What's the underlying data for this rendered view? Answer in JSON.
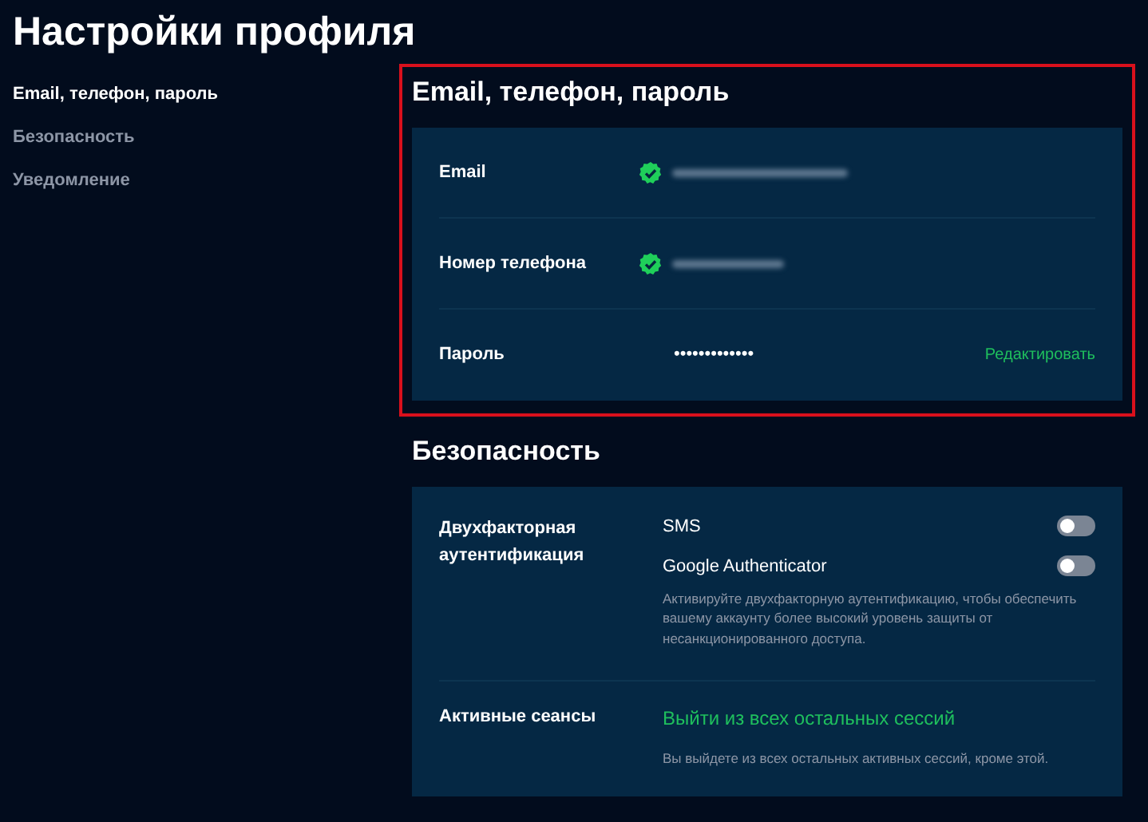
{
  "title": "Настройки профиля",
  "sidebar": {
    "items": [
      {
        "label": "Email, телефон, пароль",
        "selected": true
      },
      {
        "label": "Безопасность",
        "selected": false
      },
      {
        "label": "Уведомление",
        "selected": false
      }
    ]
  },
  "contact_section": {
    "title": "Email, телефон, пароль",
    "highlighted": true,
    "rows": [
      {
        "kind": "verified",
        "label": "Email",
        "verified": true
      },
      {
        "kind": "verified",
        "label": "Номер телефона",
        "verified": true
      },
      {
        "kind": "password",
        "label": "Пароль",
        "value": "•••••••••••••",
        "action": "Редактировать"
      }
    ]
  },
  "security_section": {
    "title": "Безопасность",
    "two_factor": {
      "label": "Двухфакторная аутентификация",
      "options": [
        {
          "label": "SMS",
          "on": false
        },
        {
          "label": "Google Authenticator",
          "on": false
        }
      ],
      "hint": "Активируйте двухфакторную аутентификацию, чтобы обеспечить вашему аккаунту более высокий уровень защиты от несанкционированного доступа."
    },
    "sessions": {
      "label": "Активные сеансы",
      "action": "Выйти из всех остальных сессий",
      "hint": "Вы выйдете из всех остальных активных сессий, кроме этой."
    }
  }
}
